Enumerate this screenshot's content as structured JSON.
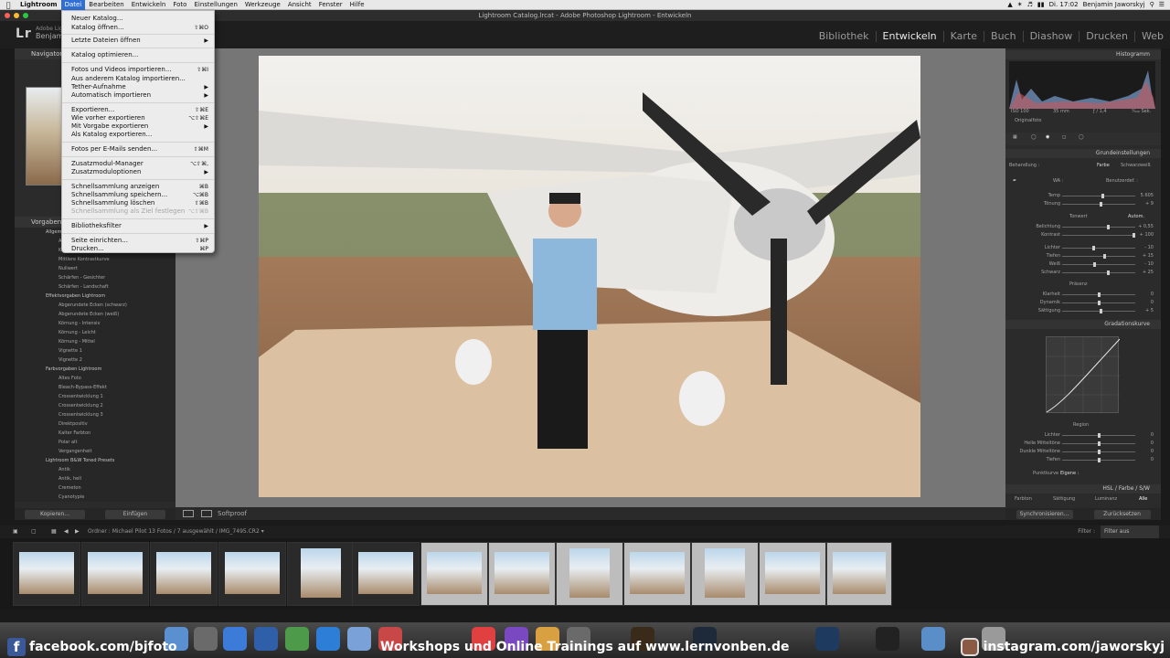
{
  "menubar": {
    "app": "Lightroom",
    "items": [
      "Datei",
      "Bearbeiten",
      "Entwickeln",
      "Foto",
      "Einstellungen",
      "Werkzeuge",
      "Ansicht",
      "Fenster",
      "Hilfe"
    ],
    "active": "Datei",
    "clock": "Di. 17:02",
    "user": "Benjamin Jaworskyj"
  },
  "window": {
    "title": "Lightroom Catalog.lrcat - Adobe Photoshop Lightroom - Entwickeln"
  },
  "lr": {
    "logo": "Lr",
    "identity_line1": "Adobe Lightr",
    "identity_line2": "Benjam",
    "modules": [
      "Bibliothek",
      "Entwickeln",
      "Karte",
      "Buch",
      "Diashow",
      "Drucken",
      "Web"
    ],
    "active_module": "Entwickeln"
  },
  "dropdown": {
    "items": [
      {
        "label": "Neuer Katalog...",
        "shortcut": ""
      },
      {
        "label": "Katalog öffnen...",
        "shortcut": "⇧⌘O"
      },
      {
        "label": "Letzte Dateien öffnen",
        "shortcut": "",
        "submenu": true
      },
      {
        "label": "Katalog optimieren...",
        "shortcut": ""
      },
      {
        "label": "Fotos und Videos importieren...",
        "shortcut": "⇧⌘I"
      },
      {
        "label": "Aus anderem Katalog importieren...",
        "shortcut": ""
      },
      {
        "label": "Tether-Aufnahme",
        "shortcut": "",
        "submenu": true
      },
      {
        "label": "Automatisch importieren",
        "shortcut": "",
        "submenu": true
      },
      {
        "label": "Exportieren...",
        "shortcut": "⇧⌘E"
      },
      {
        "label": "Wie vorher exportieren",
        "shortcut": "⌥⇧⌘E"
      },
      {
        "label": "Mit Vorgabe exportieren",
        "shortcut": "",
        "submenu": true
      },
      {
        "label": "Als Katalog exportieren...",
        "shortcut": ""
      },
      {
        "label": "Fotos per E-Mails senden...",
        "shortcut": "⇧⌘M"
      },
      {
        "label": "Zusatzmodul-Manager",
        "shortcut": "⌥⇧⌘,"
      },
      {
        "label": "Zusatzmoduloptionen",
        "shortcut": "",
        "submenu": true
      },
      {
        "label": "Schnellsammlung anzeigen",
        "shortcut": "⌘B"
      },
      {
        "label": "Schnellsammlung speichern...",
        "shortcut": "⌥⌘B"
      },
      {
        "label": "Schnellsammlung löschen",
        "shortcut": "⇧⌘B"
      },
      {
        "label": "Schnellsammlung als Ziel festlegen",
        "shortcut": "⌥⇧⌘B",
        "disabled": true
      },
      {
        "label": "Bibliotheksfilter",
        "shortcut": "",
        "submenu": true
      },
      {
        "label": "Seite einrichten...",
        "shortcut": "⇧⌘P"
      },
      {
        "label": "Drucken...",
        "shortcut": "⌘P"
      }
    ]
  },
  "left_panel": {
    "navigator": "Navigator",
    "presets_header": "Vorgaben",
    "presets": [
      {
        "type": "folder",
        "label": "Allgem"
      },
      {
        "type": "item",
        "label": "A"
      },
      {
        "type": "item",
        "label": "K"
      },
      {
        "type": "item",
        "label": "Mittlere Kontrastkurve"
      },
      {
        "type": "item",
        "label": "Nullwert"
      },
      {
        "type": "item",
        "label": "Schärfen - Gesichter"
      },
      {
        "type": "item",
        "label": "Schärfen - Landschaft"
      },
      {
        "type": "folder",
        "label": "Effektvorgaben Lightroom"
      },
      {
        "type": "item",
        "label": "Abgerundete Ecken (schwarz)"
      },
      {
        "type": "item",
        "label": "Abgerundete Ecken (weiß)"
      },
      {
        "type": "item",
        "label": "Körnung - Intensiv"
      },
      {
        "type": "item",
        "label": "Körnung - Leicht"
      },
      {
        "type": "item",
        "label": "Körnung - Mittel"
      },
      {
        "type": "item",
        "label": "Vignette 1"
      },
      {
        "type": "item",
        "label": "Vignette 2"
      },
      {
        "type": "folder",
        "label": "Farbvorgaben Lightroom"
      },
      {
        "type": "item",
        "label": "Altes Foto"
      },
      {
        "type": "item",
        "label": "Bleach-Bypass-Effekt"
      },
      {
        "type": "item",
        "label": "Crossentwicklung 1"
      },
      {
        "type": "item",
        "label": "Crossentwicklung 2"
      },
      {
        "type": "item",
        "label": "Crossentwicklung 3"
      },
      {
        "type": "item",
        "label": "Direktpositiv"
      },
      {
        "type": "item",
        "label": "Kalter Farbton"
      },
      {
        "type": "item",
        "label": "Polar alt"
      },
      {
        "type": "item",
        "label": "Vergangenheit"
      },
      {
        "type": "folder",
        "label": "Lightroom B&W Toned Presets"
      },
      {
        "type": "item",
        "label": "Antik"
      },
      {
        "type": "item",
        "label": "Antik, hell"
      },
      {
        "type": "item",
        "label": "Cremeton"
      },
      {
        "type": "item",
        "label": "Cyanotypie"
      }
    ],
    "copy_button": "Kopieren...",
    "paste_button": "Einfügen"
  },
  "toolbar": {
    "softproof": "Softproof"
  },
  "right_panel": {
    "histogram": "Histogramm",
    "iso": "ISO 100",
    "focal": "35 mm",
    "aperture": "ƒ / 1,4",
    "shutter": "¹⁄₆₄₀ Sek.",
    "original": "Originalfoto",
    "basic": "Grundeinstellungen",
    "treatment": "Behandlung :",
    "color": "Farbe",
    "bw": "Schwarzweiß",
    "wb": "WA :",
    "wb_value": "Benutzerdef. :",
    "tone": "Tonwert",
    "auto": "Autom.",
    "presence": "Präsenz",
    "curve": "Gradationskurve",
    "region": "Region",
    "point_curve": "Punktkurve :",
    "point_curve_value": "Eigene :",
    "hsl_tabs": "HSL / Farbe / S/W",
    "sub_tabs": [
      "Farbton",
      "Sättigung",
      "Luminanz",
      "Alle"
    ],
    "sliders": [
      {
        "label": "Temp",
        "value": "5.605",
        "pos": 0.55
      },
      {
        "label": "Tönung",
        "value": "+ 9",
        "pos": 0.52
      },
      {
        "label": "Belichtung",
        "value": "+ 0,55",
        "pos": 0.62
      },
      {
        "label": "Kontrast",
        "value": "+ 100",
        "pos": 0.98
      },
      {
        "label": "Lichter",
        "value": "- 10",
        "pos": 0.42
      },
      {
        "label": "Tiefen",
        "value": "+ 15",
        "pos": 0.58
      },
      {
        "label": "Weiß",
        "value": "- 10",
        "pos": 0.44
      },
      {
        "label": "Schwarz",
        "value": "+ 25",
        "pos": 0.62
      },
      {
        "label": "Klarheit",
        "value": "0",
        "pos": 0.5
      },
      {
        "label": "Dynamik",
        "value": "0",
        "pos": 0.5
      },
      {
        "label": "Sättigung",
        "value": "+ 5",
        "pos": 0.52
      },
      {
        "label": "Lichter",
        "value": "0",
        "pos": 0.5
      },
      {
        "label": "Helle Mitteltöne",
        "value": "0",
        "pos": 0.5
      },
      {
        "label": "Dunkle Mitteltöne",
        "value": "0",
        "pos": 0.5
      },
      {
        "label": "Tiefen",
        "value": "0",
        "pos": 0.5
      }
    ],
    "sync_button": "Synchronisieren...",
    "reset_button": "Zurücksetzen"
  },
  "filmbar": {
    "text": "Ordner : Michael Pilot   13 Fotos / 7 ausgewählt / IMG_7495.CR2 ▾",
    "filter_label": "Filter :",
    "filter_value": "Filter aus"
  },
  "banner": {
    "facebook": "facebook.com/bjfoto",
    "center": "Workshops und Online Trainings auf www.lernvonben.de",
    "instagram": "instagram.com/jaworskyj"
  },
  "colors": {
    "menu_highlight": "#2f6fd6",
    "lr_bg": "#2b2b2b",
    "facebook": "#3b5998"
  }
}
